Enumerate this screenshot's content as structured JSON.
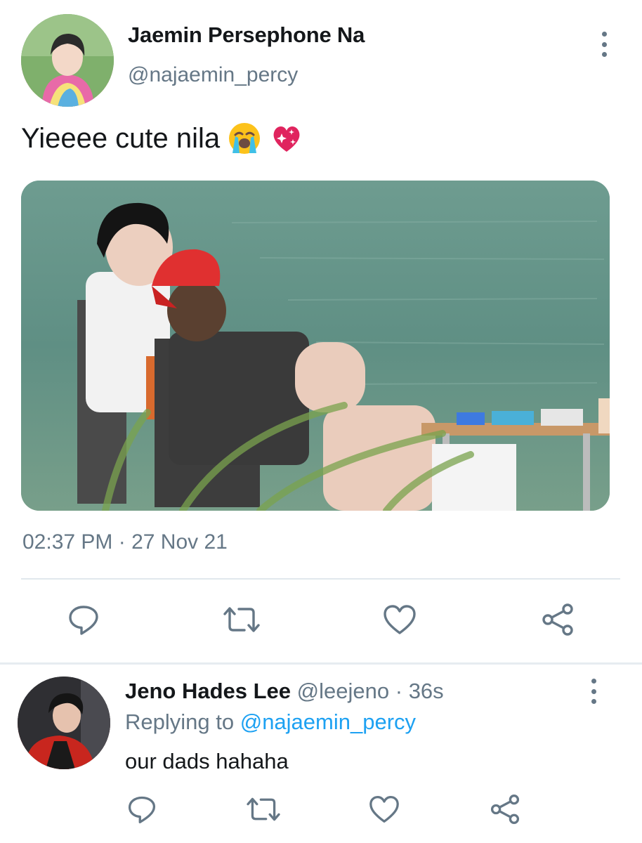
{
  "tweet": {
    "author": {
      "display_name": "Jaemin Persephone Na",
      "handle": "@najaemin_percy"
    },
    "text": "Yieeee cute nila",
    "emojis": [
      "loudly-crying-face",
      "sparkling-heart"
    ],
    "timestamp": "02:37 PM · 27 Nov 21",
    "actions": [
      "reply-icon",
      "retweet-icon",
      "like-icon",
      "share-icon"
    ]
  },
  "reply": {
    "author": {
      "display_name": "Jeno Hades Lee",
      "handle": "@leejeno",
      "separator": " · ",
      "age": "36s"
    },
    "replying_to_label": "Replying to ",
    "replying_to_handle": "@najaemin_percy",
    "text": "our dads hahaha",
    "actions": [
      "reply-icon",
      "retweet-icon",
      "like-icon",
      "share-icon"
    ]
  },
  "colors": {
    "text_primary": "#14171a",
    "text_secondary": "#657786",
    "accent": "#1da1f2",
    "divider": "#e1e8ed"
  }
}
